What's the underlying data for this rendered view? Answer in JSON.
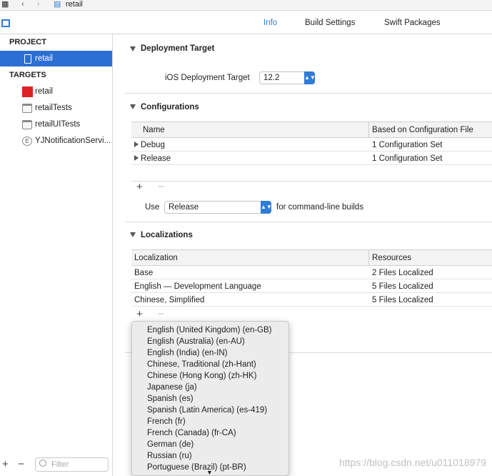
{
  "topbar": {
    "grid_icon": "grid-icon",
    "file_title": "retail"
  },
  "tabs": [
    {
      "label": "Info"
    },
    {
      "label": "Build Settings"
    },
    {
      "label": "Swift Packages"
    }
  ],
  "sidebar": {
    "project_header": "PROJECT",
    "project_item": "retail",
    "targets_header": "TARGETS",
    "targets": [
      {
        "label": "retail"
      },
      {
        "label": "retailTests"
      },
      {
        "label": "retailUITests"
      },
      {
        "label": "YJNotificationServi..."
      }
    ],
    "filter_placeholder": "Filter"
  },
  "deployment": {
    "header": "Deployment Target",
    "label": "iOS Deployment Target",
    "value": "12.2"
  },
  "configurations": {
    "header": "Configurations",
    "columns": [
      "Name",
      "Based on Configuration File"
    ],
    "rows": [
      {
        "name": "Debug",
        "value": "1 Configuration Set"
      },
      {
        "name": "Release",
        "value": "1 Configuration Set"
      }
    ],
    "use_label": "Use",
    "use_value": "Release",
    "use_suffix": "for command-line builds"
  },
  "localizations": {
    "header": "Localizations",
    "columns": [
      "Localization",
      "Resources"
    ],
    "rows": [
      {
        "name": "Base",
        "value": "2 Files Localized"
      },
      {
        "name": "English — Development Language",
        "value": "5 Files Localized"
      },
      {
        "name": "Chinese, Simplified",
        "value": "5 Files Localized"
      }
    ]
  },
  "popup": {
    "items": [
      "English (United Kingdom) (en-GB)",
      "English (Australia) (en-AU)",
      "English (India) (en-IN)",
      "Chinese, Traditional (zh-Hant)",
      "Chinese (Hong Kong) (zh-HK)",
      "Japanese (ja)",
      "Spanish (es)",
      "Spanish (Latin America) (es-419)",
      "French (fr)",
      "French (Canada) (fr-CA)",
      "German (de)",
      "Russian (ru)",
      "Portuguese (Brazil) (pt-BR)"
    ]
  },
  "watermark": "https://blog.csdn.net/u011018979",
  "colors": {
    "accent": "#2f7cd6",
    "selection": "#2c6fd3"
  }
}
